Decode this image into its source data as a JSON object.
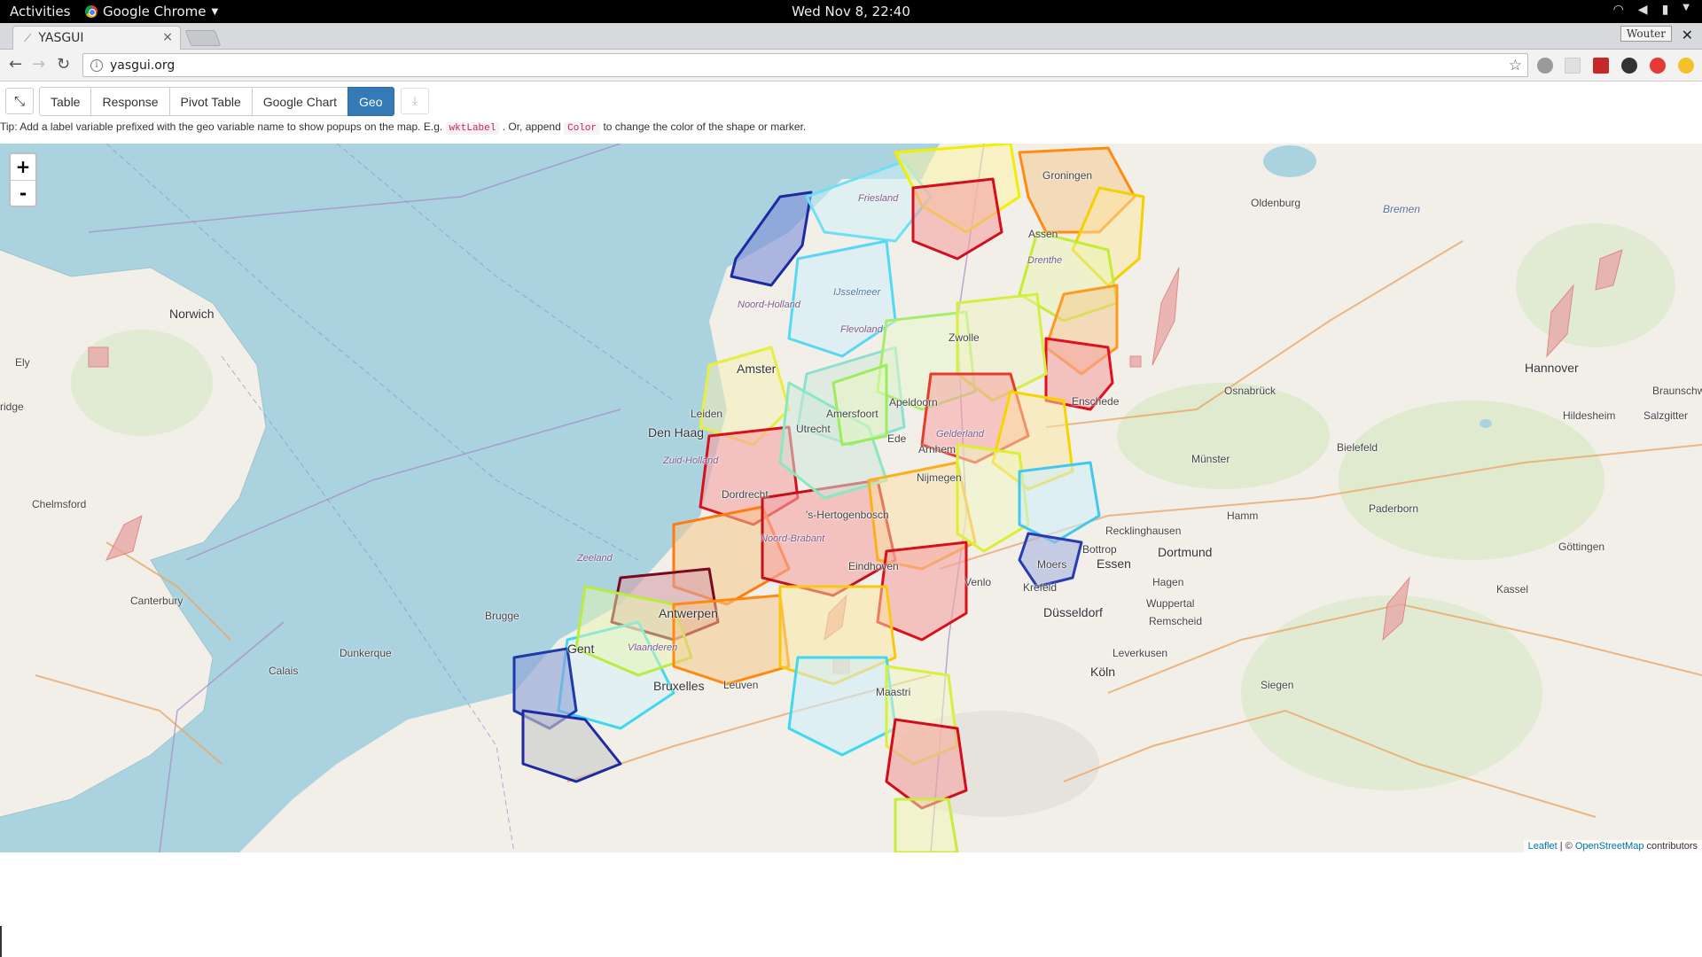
{
  "system_bar": {
    "activities": "Activities",
    "app_name": "Google Chrome",
    "clock": "Wed Nov  8, 22:40"
  },
  "browser": {
    "tab_title": "YASGUI",
    "url": "yasgui.org",
    "profile_name": "Wouter",
    "tab_close": "×",
    "window_close": "✕"
  },
  "yasr": {
    "plugins": [
      {
        "label": "Table",
        "active": false
      },
      {
        "label": "Response",
        "active": false
      },
      {
        "label": "Pivot Table",
        "active": false
      },
      {
        "label": "Google Chart",
        "active": false
      },
      {
        "label": "Geo",
        "active": true
      }
    ],
    "tip": {
      "part1": "Tip: Add a label variable prefixed with the geo variable name to show popups on the map. E.g.",
      "code1": "wktLabel",
      "part2": ". Or, append",
      "code2": "Color",
      "part3": "to change the color of the shape or marker."
    }
  },
  "map": {
    "zoom_in": "+",
    "zoom_out": "-",
    "attribution": {
      "leaflet": "Leaflet",
      "separator": " | © ",
      "osm": "OpenStreetMap",
      "suffix": " contributors"
    },
    "place_labels": {
      "norwich": "Norwich",
      "ely": "Ely",
      "ridge": "ridge",
      "chelmsford": "Chelmsford",
      "canterbury": "Canterbury",
      "dunkerque": "Dunkerque",
      "calais": "Calais",
      "brugge": "Brugge",
      "gent": "Gent",
      "vlaanderen": "Vlaanderen",
      "antwerpen": "Antwerpen",
      "bruxelles": "Bruxelles",
      "leuven": "Leuven",
      "maastricht": "Maastri",
      "den_haag": "Den Haag",
      "amsterdam": "Amster",
      "apeldoorn": "Apeldoorn",
      "enschede": "Enschede",
      "ede": "Ede",
      "gelderland": "Gelderland",
      "noord_holland": "Noord-Holland",
      "flevoland": "Flevoland",
      "ijsselmeer": "IJsselmeer",
      "friesland": "Friesland",
      "groningen": "Groningen",
      "drenthe": "Drenthe",
      "assen": "Assen",
      "zwolle": "Zwolle",
      "oldenburg": "Oldenburg",
      "bremen": "Bremen",
      "hannover": "Hannover",
      "osnabruck": "Osnabrück",
      "bielefeld": "Bielefeld",
      "munster": "Münster",
      "hildesheim": "Hildesheim",
      "salzgitter": "Salzgitter",
      "braunschweig": "Braunschweig",
      "hamm": "Hamm",
      "paderborn": "Paderborn",
      "recklinghausen": "Recklinghausen",
      "bottrop": "Bottrop",
      "essen": "Essen",
      "dortmund": "Dortmund",
      "hagen": "Hagen",
      "moers": "Moers",
      "krefeld": "Krefeld",
      "dusseldorf": "Düsseldorf",
      "wuppertal": "Wuppertal",
      "remscheid": "Remscheid",
      "leverkusen": "Leverkusen",
      "koln": "Köln",
      "siegen": "Siegen",
      "gottingen": "Göttingen",
      "kassel": "Kassel",
      "venlo": "Venlo",
      "eindhoven": "Eindhoven",
      "hertogenbosch": "'s-Hertogenbosch",
      "noord_brabant": "Noord-Brabant",
      "zeeland": "Zeeland",
      "utrecht": "Utrecht",
      "amersfoort": "Amersfoort",
      "leiden": "Leiden",
      "zuid_holland": "Zuid-Holland",
      "dordrecht": "Dordrecht",
      "nijmegen": "Nijmegen",
      "arnhem": "Arnhem"
    }
  },
  "colors": {
    "active_button": "#337ab7",
    "sea": "#aad3df",
    "land": "#f1efe8",
    "link": "#0078a8"
  }
}
